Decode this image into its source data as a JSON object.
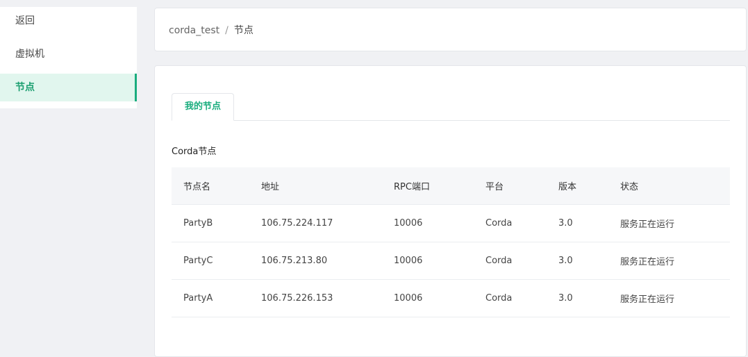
{
  "sidebar": {
    "items": [
      {
        "label": "返回"
      },
      {
        "label": "虚拟机"
      },
      {
        "label": "节点"
      }
    ]
  },
  "breadcrumb": {
    "parent": "corda_test",
    "separator": "/",
    "current": "节点"
  },
  "tabs": [
    {
      "label": "我的节点"
    }
  ],
  "section_title": "Corda节点",
  "table": {
    "headers": [
      "节点名",
      "地址",
      "RPC端口",
      "平台",
      "版本",
      "状态"
    ],
    "rows": [
      [
        "PartyB",
        "106.75.224.117",
        "10006",
        "Corda",
        "3.0",
        "服务正在运行"
      ],
      [
        "PartyC",
        "106.75.213.80",
        "10006",
        "Corda",
        "3.0",
        "服务正在运行"
      ],
      [
        "PartyA",
        "106.75.226.153",
        "10006",
        "Corda",
        "3.0",
        "服务正在运行"
      ]
    ]
  },
  "colors": {
    "accent": "#1aad7e",
    "active_bg": "#e1f6ee",
    "page_bg": "#f0f1f4"
  }
}
